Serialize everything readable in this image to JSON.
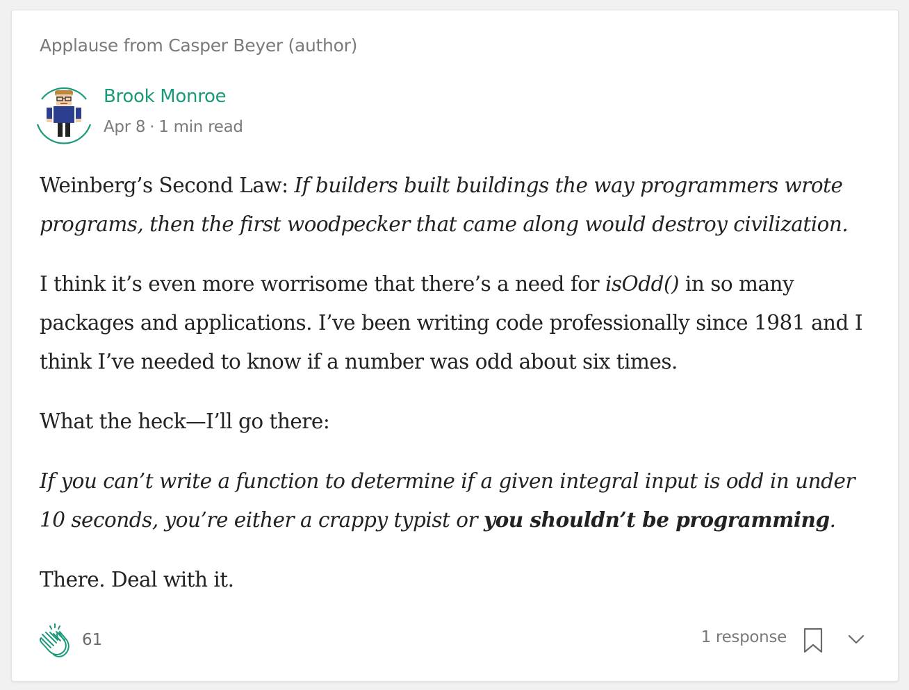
{
  "applause": {
    "text": "Applause from Casper Beyer (author)"
  },
  "author": {
    "name": "Brook Monroe",
    "date": "Apr 8",
    "separator": "·",
    "read_time": "1 min read"
  },
  "post": {
    "p1_prefix": "Weinberg’s Second Law: ",
    "p1_italic": "If builders built buildings the way programmers wrote programs, then the first woodpecker that came along would destroy civilization.",
    "p2_prefix": "I think it’s even more worrisome that there’s a need for ",
    "p2_italic": "isOdd()",
    "p2_suffix": " in so many packages and applications. I’ve been writing code professionally since 1981 and I think I’ve needed to know if a number was odd about six times.",
    "p3": "What the heck—I’ll go there:",
    "p4_italic": "If you can’t write a function to determine if a given integral input is odd in under 10 seconds, you’re either a crappy typist or ",
    "p4_bold": "you shouldn’t be programming",
    "p4_end": ".",
    "p5": "There. Deal with it."
  },
  "footer": {
    "clap_count": "61",
    "responses": "1 response"
  },
  "icons": {
    "clap": "clap-icon",
    "bookmark": "bookmark-icon",
    "chevron": "chevron-down-icon",
    "avatar": "avatar"
  },
  "colors": {
    "accent": "#1a9a7a",
    "muted_text": "#7a7a7a",
    "body_text": "#222222"
  }
}
